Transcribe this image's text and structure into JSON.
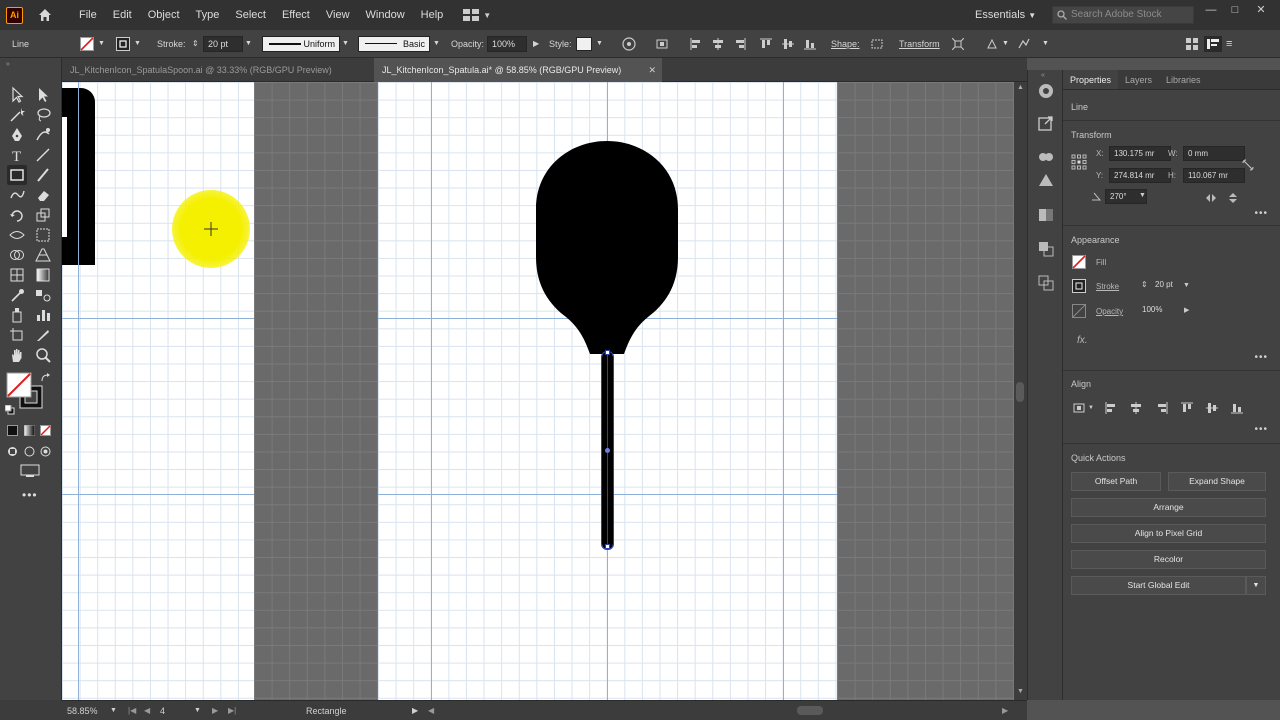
{
  "app": {
    "logo": "Ai"
  },
  "menu": [
    "File",
    "Edit",
    "Object",
    "Type",
    "Select",
    "Effect",
    "View",
    "Window",
    "Help"
  ],
  "workspace": "Essentials",
  "stock_search": {
    "placeholder": "Search Adobe Stock"
  },
  "window_controls": {
    "minimize": "—",
    "maximize": "□",
    "close": "✕"
  },
  "control": {
    "selection_type": "Line",
    "stroke_label": "Stroke:",
    "stroke_value": "20 pt",
    "profile": "Uniform",
    "brush": "Basic",
    "opacity_label": "Opacity:",
    "opacity_value": "100%",
    "style_label": "Style:",
    "shape_label": "Shape:",
    "transform_label": "Transform"
  },
  "tabs": [
    {
      "label": "JL_KitchenIcon_SpatulaSpoon.ai @ 33.33% (RGB/GPU Preview)"
    },
    {
      "label": "JL_KitchenIcon_Spatula.ai* @ 58.85% (RGB/GPU Preview)",
      "close": "✕"
    }
  ],
  "properties": {
    "tabs": [
      "Properties",
      "Layers",
      "Libraries"
    ],
    "selection": "Line",
    "transform": {
      "title": "Transform",
      "x_label": "X:",
      "x": "130.175 mr",
      "y_label": "Y:",
      "y": "274.814 mr",
      "w_label": "W:",
      "w": "0 mm",
      "h_label": "H:",
      "h": "110.067 mr",
      "angle": "270°"
    },
    "appearance": {
      "title": "Appearance",
      "fill_label": "Fill",
      "stroke_label": "Stroke",
      "stroke_value": "20 pt",
      "opacity_label": "Opacity",
      "opacity_value": "100%",
      "fx": "fx."
    },
    "align": {
      "title": "Align"
    },
    "quick_actions": {
      "title": "Quick Actions",
      "offset_path": "Offset Path",
      "expand_shape": "Expand Shape",
      "arrange": "Arrange",
      "align_pixel": "Align to Pixel Grid",
      "recolor": "Recolor",
      "global_edit": "Start Global Edit"
    }
  },
  "status": {
    "zoom": "58.85%",
    "artboard": "4",
    "tool": "Rectangle"
  },
  "colors": {
    "highlight": "#f5f000",
    "shape": "#000000",
    "selection": "#2a3fb5",
    "app_accent": "#ff9a00"
  }
}
